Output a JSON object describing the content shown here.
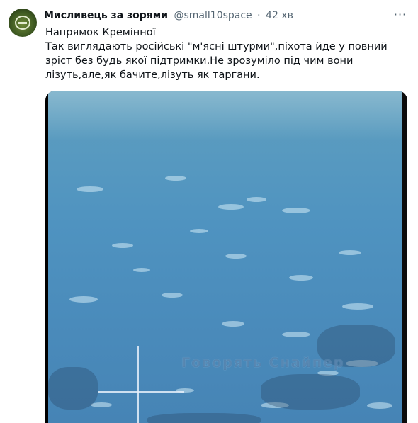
{
  "author": {
    "display_name": "Мисливець за зорями",
    "handle": "@small10space",
    "separator": "·",
    "time": "42 хв"
  },
  "icons": {
    "avatar": "avatar-emblem",
    "more": "more-horizontal-icon"
  },
  "more_glyph": "···",
  "tweet": {
    "line1": "Напрямок Кремінної",
    "line2": "Так виглядають російські \"м'ясні штурми\",піхота йде у повний зріст без будь якої підтримки.Не зрозуміло під чим вони лізуть,але,як бачите,лізуть як таргани."
  },
  "media": {
    "watermark": "Говорять Снайпер"
  }
}
